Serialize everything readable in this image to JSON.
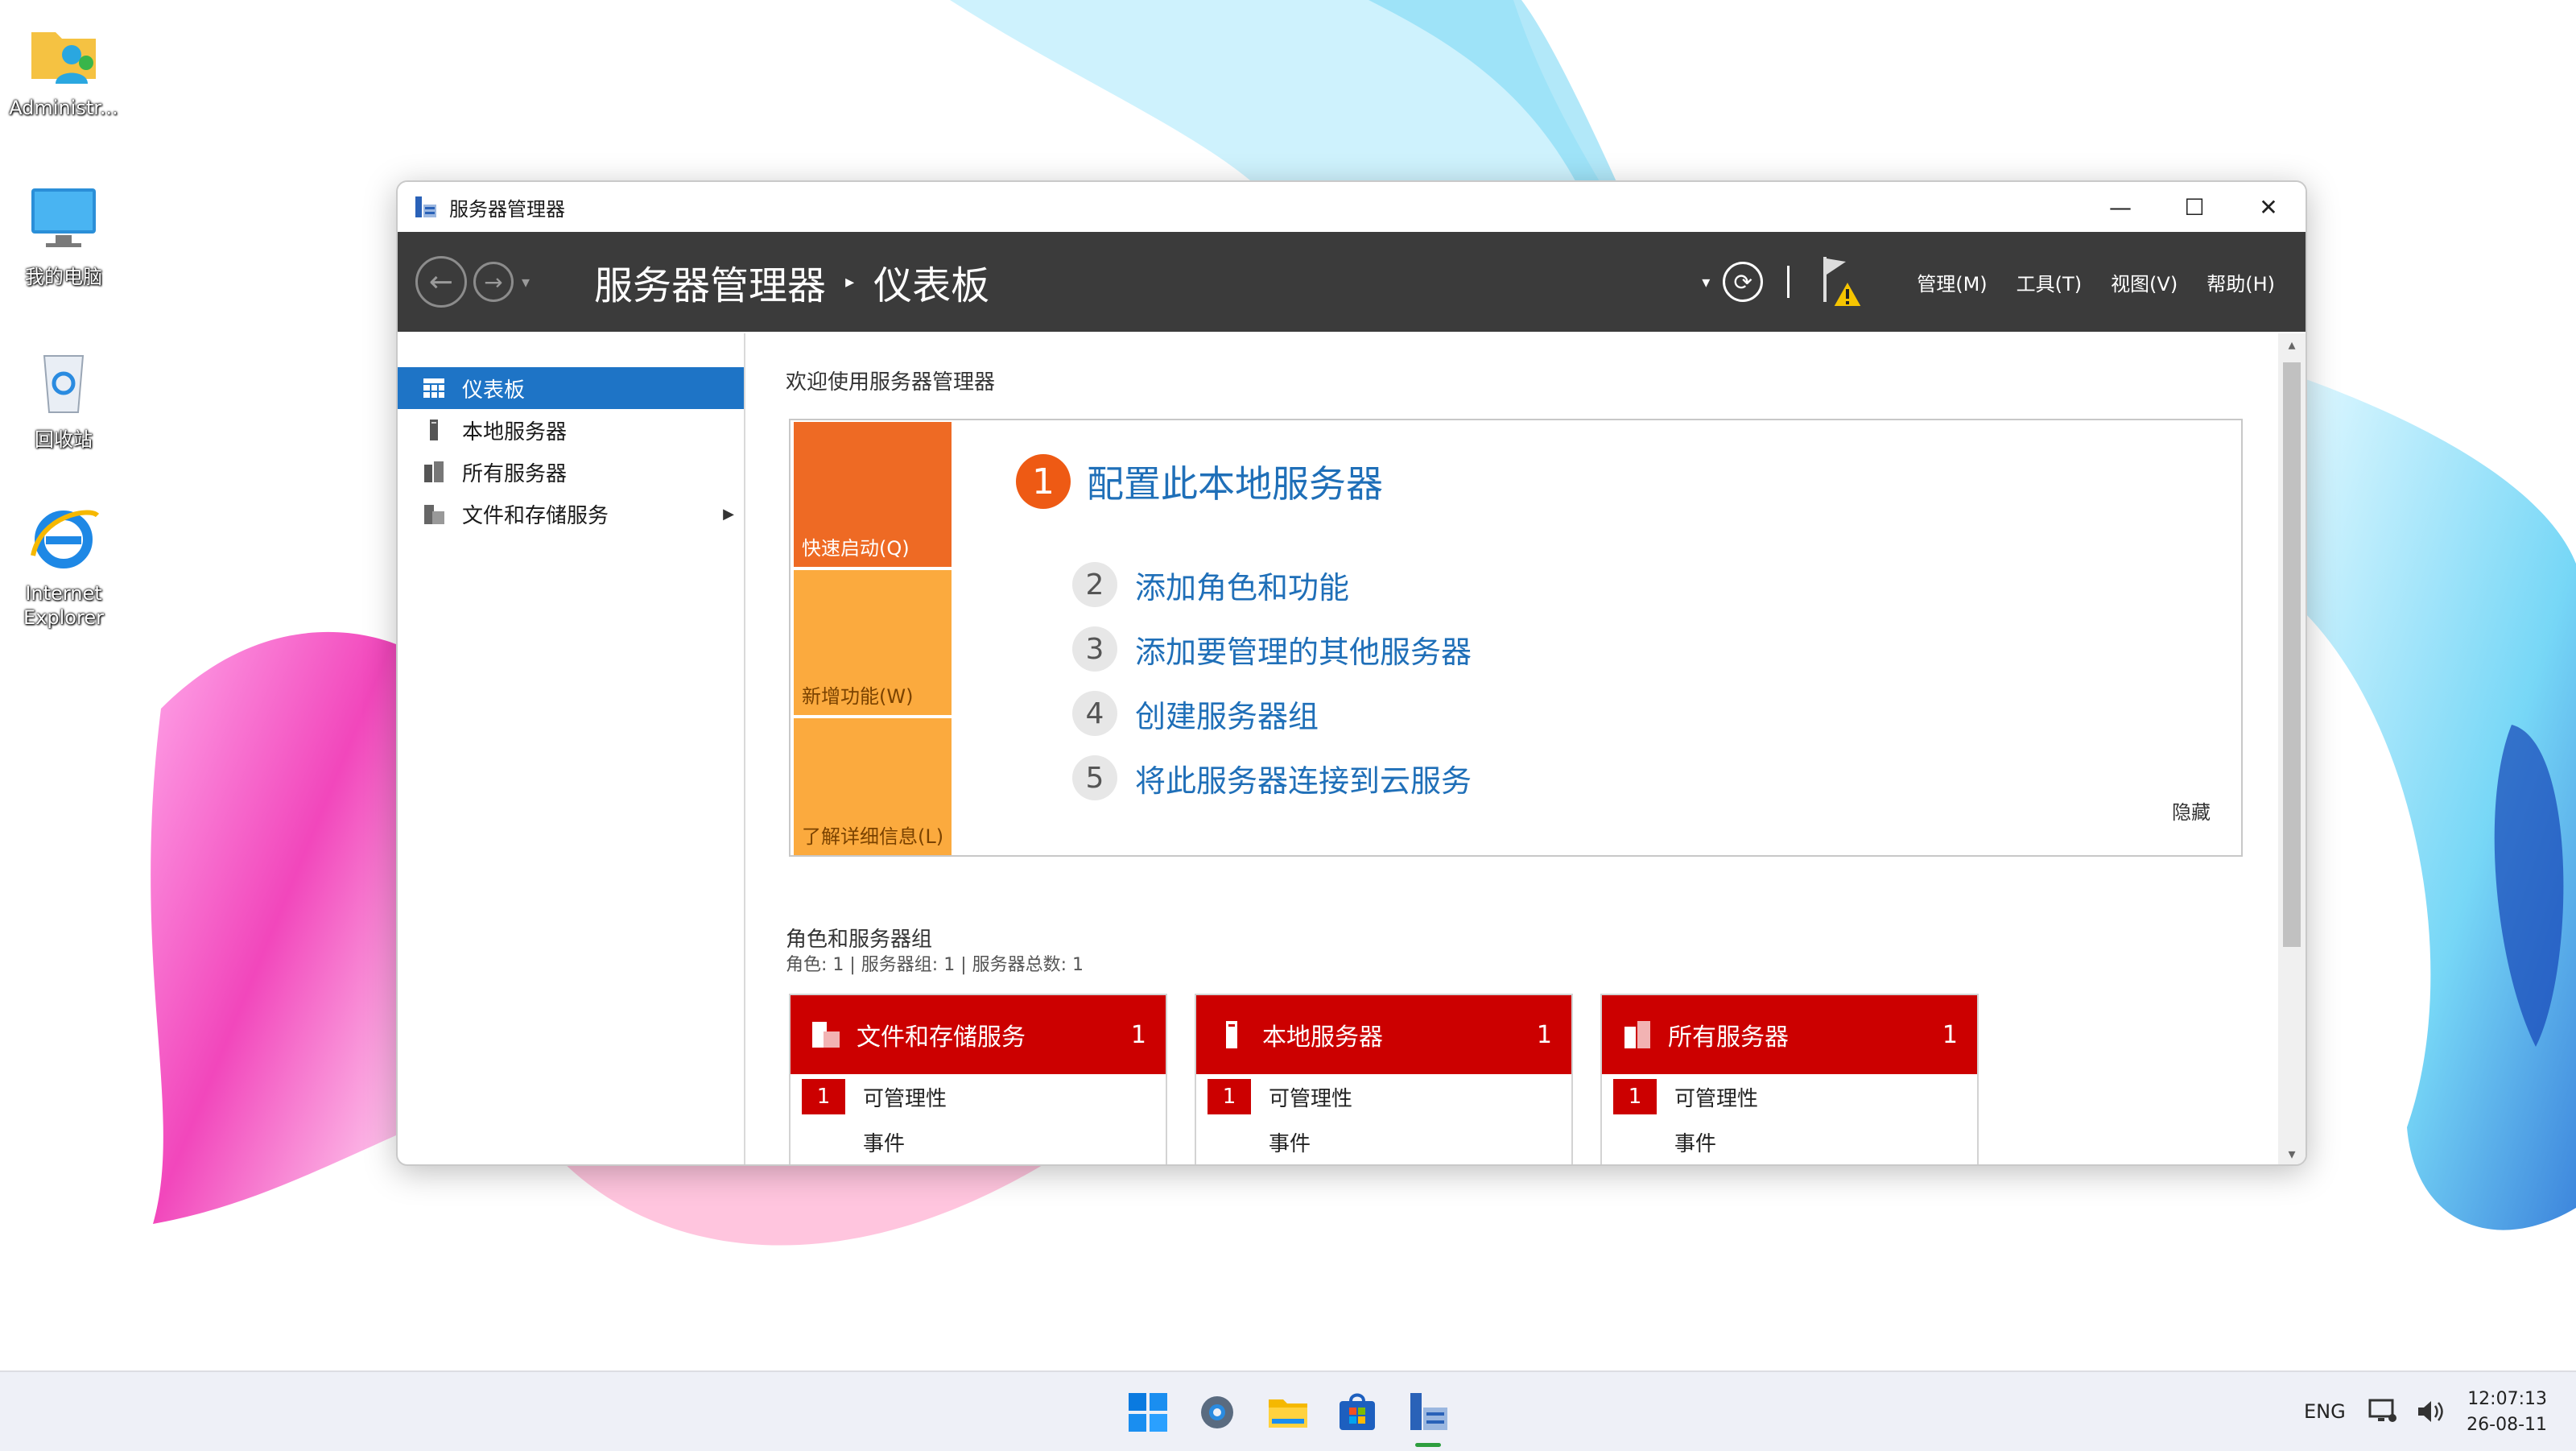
{
  "desktop": {
    "icons": [
      {
        "label": "Administr..."
      },
      {
        "label": "我的电脑"
      },
      {
        "label": "回收站"
      },
      {
        "label": "Internet Explorer"
      }
    ]
  },
  "window": {
    "title": "服务器管理器",
    "controls": {
      "minimize": "—",
      "maximize": "☐",
      "close": "✕"
    }
  },
  "commandbar": {
    "breadcrumb_root": "服务器管理器",
    "breadcrumb_sep": "▸",
    "breadcrumb_current": "仪表板",
    "menus": [
      "管理(M)",
      "工具(T)",
      "视图(V)",
      "帮助(H)"
    ]
  },
  "sidebar": {
    "items": [
      {
        "label": "仪表板",
        "active": true
      },
      {
        "label": "本地服务器"
      },
      {
        "label": "所有服务器"
      },
      {
        "label": "文件和存储服务"
      }
    ]
  },
  "main": {
    "welcome": "欢迎使用服务器管理器",
    "tiles": [
      "快速启动(Q)",
      "新增功能(W)",
      "了解详细信息(L)"
    ],
    "steps": [
      {
        "num": "1",
        "text": "配置此本地服务器"
      },
      {
        "num": "2",
        "text": "添加角色和功能"
      },
      {
        "num": "3",
        "text": "添加要管理的其他服务器"
      },
      {
        "num": "4",
        "text": "创建服务器组"
      },
      {
        "num": "5",
        "text": "将此服务器连接到云服务"
      }
    ],
    "hide": "隐藏",
    "roles_title": "角色和服务器组",
    "roles_sub": "角色: 1 | 服务器组: 1 | 服务器总数: 1",
    "cards": [
      {
        "name": "文件和存储服务",
        "count": "1",
        "manage_badge": "1",
        "manage": "可管理性",
        "events": "事件"
      },
      {
        "name": "本地服务器",
        "count": "1",
        "manage_badge": "1",
        "manage": "可管理性",
        "events": "事件"
      },
      {
        "name": "所有服务器",
        "count": "1",
        "manage_badge": "1",
        "manage": "可管理性",
        "events": "事件"
      }
    ]
  },
  "taskbar": {
    "lang": "ENG",
    "time": "12:07:13",
    "date": "26-08-11"
  },
  "colors": {
    "accent": "#1e74c6",
    "command_bar": "#3b3b3b",
    "tile_orange": "#ee6a24",
    "tile_amber": "#fbaa3e",
    "card_red": "#cc0000",
    "link_blue": "#1f6fb8"
  }
}
